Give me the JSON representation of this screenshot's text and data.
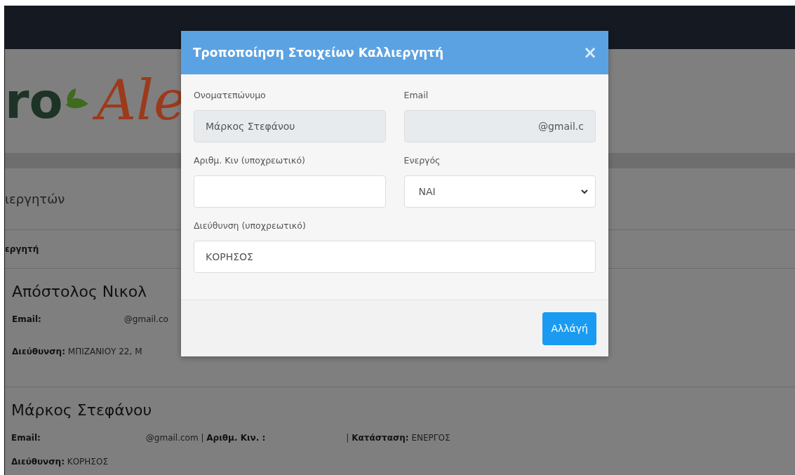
{
  "background": {
    "logo": {
      "left": "ro",
      "right": "Ale"
    },
    "page_heading": "ιεργητών",
    "table_header": "εργητή",
    "entries": [
      {
        "name": "Απόστολος Νικολ",
        "lines": [
          [
            "**Email:**",
            "@gmail.co"
          ],
          [
            "**Διεύθυνση:** ΜΠΙΖΑΝΙΟΥ 22, Μ"
          ]
        ]
      },
      {
        "name": "Μάρκος Στεφάνου",
        "lines": [
          [
            "**Email:**",
            "@gmail.com | **Αριθμ. Κιν. :**",
            "| **Κατάσταση:** ΕΝΕΡΓΟΣ"
          ],
          [
            "**Διεύθυνση:** ΚΟΡΗΣΟΣ"
          ]
        ]
      }
    ]
  },
  "modal": {
    "title": "Τροποποίηση Στοιχείων Καλλιεργητή",
    "close": "×",
    "fields": [
      {
        "kind": "text",
        "label": "Ονοματεπώνυμο",
        "value": "Μάρκος Στεφάνου",
        "disabled": true
      },
      {
        "kind": "text",
        "label": "Email",
        "value": "@gmail.c",
        "disabled": true
      },
      {
        "kind": "text",
        "label": "Αριθμ. Κιν (υποχρεωτικό)",
        "disabled": false
      },
      {
        "kind": "select",
        "label": "Ενεργός",
        "value": "ΝΑΙ",
        "disabled": false
      },
      {
        "kind": "text",
        "label": "Διεύθυνση (υποχρεωτικό)",
        "value": "ΚΟΡΗΣΟΣ",
        "disabled": false
      }
    ],
    "button": "Αλλάγή"
  }
}
